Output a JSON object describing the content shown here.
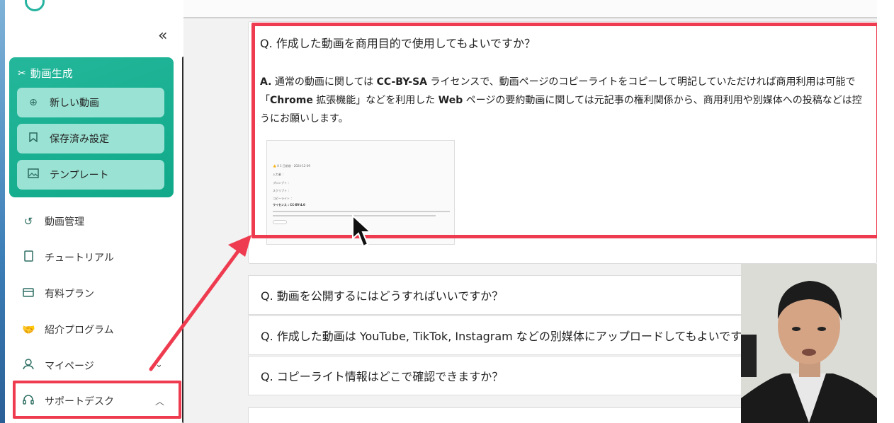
{
  "sidebar": {
    "collapse_icon": "«",
    "generation": {
      "title": "動画生成",
      "buttons": [
        {
          "label": "新しい動画",
          "icon": "plus-circle-icon"
        },
        {
          "label": "保存済み設定",
          "icon": "bookmark-icon"
        },
        {
          "label": "テンプレート",
          "icon": "image-icon"
        }
      ]
    },
    "nav": [
      {
        "label": "動画管理",
        "icon": "history-icon"
      },
      {
        "label": "チュートリアル",
        "icon": "book-icon"
      },
      {
        "label": "有料プラン",
        "icon": "card-icon"
      },
      {
        "label": "紹介プログラム",
        "icon": "handshake-icon"
      },
      {
        "label": "マイページ",
        "icon": "user-icon"
      },
      {
        "label": "サポートデスク",
        "icon": "headset-icon"
      }
    ]
  },
  "faq": {
    "expanded": {
      "question": "Q. 作成した動画を商用目的で使用してもよいですか？",
      "answer_prefix": "A.",
      "answer_line1_a": " 通常の動画に関しては ",
      "answer_line1_b": "CC-BY-SA",
      "answer_line1_c": " ライセンスで、動画ページのコピーライトをコピーして明記していただければ商用利用は可能で",
      "answer_line2_a": "「",
      "answer_line2_b": "Chrome",
      "answer_line2_c": " 拡張機能」などを利用した ",
      "answer_line2_d": "Web",
      "answer_line2_e": " ページの要約動画に関しては元記事の権利関係から、商用利用や別媒体への投稿などは控",
      "answer_line3": "うにお願いします。",
      "thumbnail": {
        "rows": [
          "👍 0   1 日前前 · 2024-12-09",
          "入力者 ：",
          "プロンプト ：",
          "スクリプト ：",
          "コピーライト ：",
          "ライセンス : CC-BY-4.0"
        ]
      }
    },
    "items": [
      "Q. 動画を公開するにはどうすればいいですか？",
      "Q. 作成した動画は YouTube, TikTok, Instagram などの別媒体にアップロードしてもよいです",
      "Q. コピーライト情報はどこで確認できますか？"
    ]
  },
  "colors": {
    "accent": "#1bb296",
    "highlight": "#ef3b4f"
  }
}
